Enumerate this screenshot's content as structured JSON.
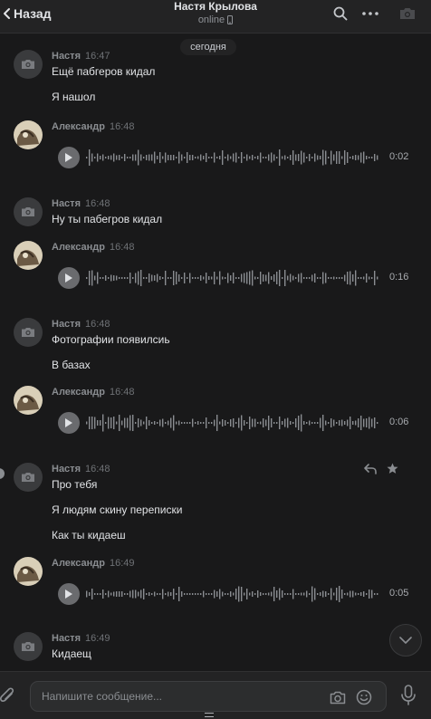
{
  "header": {
    "back_label": "Назад",
    "name": "Настя Крылова",
    "status": "online"
  },
  "chat": {
    "date_label": "сегодня",
    "messages": [
      {
        "author": "Настя",
        "time": "16:47",
        "lines": [
          "Ещё пабгеров кидал",
          "Я нашол"
        ]
      },
      {
        "author": "Александр",
        "time": "16:48",
        "voice_duration": "0:02"
      },
      {
        "author": "Настя",
        "time": "16:48",
        "lines": [
          "Ну ты пабегров кидал"
        ]
      },
      {
        "author": "Александр",
        "time": "16:48",
        "voice_duration": "0:16"
      },
      {
        "author": "Настя",
        "time": "16:48",
        "lines": [
          "Фотографии появилсиь",
          "В базах"
        ]
      },
      {
        "author": "Александр",
        "time": "16:48",
        "voice_duration": "0:06"
      },
      {
        "author": "Настя",
        "time": "16:48",
        "lines": [
          "Про тебя",
          "Я людям скину переписки",
          "Как ты кидаеш"
        ]
      },
      {
        "author": "Александр",
        "time": "16:49",
        "voice_duration": "0:05"
      },
      {
        "author": "Настя",
        "time": "16:49",
        "lines": [
          "Кидаещ"
        ]
      }
    ]
  },
  "composer": {
    "placeholder": "Напишите сообщение..."
  },
  "icons": {
    "back": "chevron-left-icon",
    "search": "search-icon",
    "more": "more-horizontal-icon",
    "camera": "camera-icon",
    "reply": "reply-icon",
    "star": "star-icon",
    "play": "play-icon",
    "attach": "paperclip-icon",
    "emoji": "smile-icon",
    "mic": "microphone-icon",
    "scroll": "chevron-down-icon"
  },
  "colors": {
    "background": "#19191a",
    "header": "#232324",
    "text": "#e1e3e6",
    "secondary": "#8a8d91"
  }
}
